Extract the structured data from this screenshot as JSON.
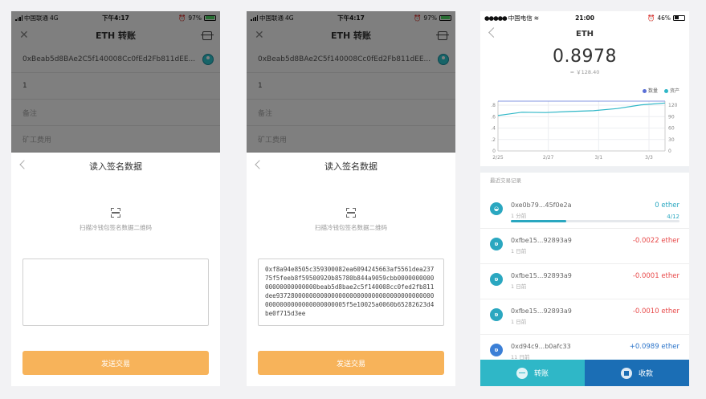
{
  "status_left": {
    "carrier": "中国联通",
    "network": "4G",
    "time": "下午4:17",
    "battery": "97%"
  },
  "status_right": {
    "carrier": "中国电信",
    "time": "21:00",
    "battery": "46%"
  },
  "transfer": {
    "title": "ETH 转账",
    "address": "0xBeab5d8BAe2C5f140008Cc0fEd2Fb811dEE...",
    "amount": "1",
    "memo_placeholder": "备注",
    "fee_label": "矿工费用"
  },
  "sheet": {
    "title": "读入签名数据",
    "scan_hint": "扫描冷钱包签名数据二维码",
    "sig_data": "0xf8a94e8505c359300082ea6094245663af5561dea23775f5feeb8f59500920b85780b844a9059cbb000000000000000000000000beab5d8bae2c5f140008cc0fed2fb811dee93728000000000000000000000000000000000000000000000000000000000005f5e10025a0060b65282623d4be0f715d3ee",
    "send_label": "发送交易"
  },
  "wallet": {
    "title": "ETH",
    "balance": "0.8978",
    "fiat": "≈ ￥128.40",
    "legend": [
      {
        "name": "数量",
        "color": "#5a6fd6"
      },
      {
        "name": "资产",
        "color": "#2fb7c7"
      }
    ],
    "records_title": "最近交易记录",
    "transactions": [
      {
        "addr": "0xe0b79...45f0e2a",
        "time": "1 分前",
        "amount": "0 ether",
        "type": "zero",
        "icon": "wallet-icon",
        "confirm": "4/12",
        "progress": 0.33
      },
      {
        "addr": "0xfbe15...92893a9",
        "time": "1 日前",
        "amount": "-0.0022 ether",
        "type": "neg",
        "icon": "link-icon"
      },
      {
        "addr": "0xfbe15...92893a9",
        "time": "1 日前",
        "amount": "-0.0001 ether",
        "type": "neg",
        "icon": "link-icon"
      },
      {
        "addr": "0xfbe15...92893a9",
        "time": "1 日前",
        "amount": "-0.0010 ether",
        "type": "neg",
        "icon": "link-icon"
      },
      {
        "addr": "0xd94c9...b0afc33",
        "time": "11 日前",
        "amount": "+0.0989 ether",
        "type": "pos",
        "icon": "link-icon"
      }
    ],
    "tabs": {
      "send": "转账",
      "receive": "收款"
    }
  },
  "chart_data": {
    "type": "line",
    "x": [
      "2/25",
      "2/27",
      "3/1",
      "3/3"
    ],
    "y_left_ticks": [
      ".8",
      ".6",
      ".4",
      ".2",
      "0"
    ],
    "y_right_ticks": [
      "120",
      "90",
      "60",
      "30",
      "0"
    ],
    "series": [
      {
        "name": "数量",
        "axis": "left",
        "values": [
          0.9,
          0.9,
          0.9,
          0.9,
          0.9,
          0.9,
          0.9,
          0.9
        ]
      },
      {
        "name": "资产",
        "axis": "right",
        "values": [
          96,
          105,
          104,
          107,
          109,
          115,
          125,
          130
        ]
      }
    ],
    "ylim_left": [
      0,
      0.9
    ],
    "ylim_right": [
      0,
      135
    ]
  }
}
